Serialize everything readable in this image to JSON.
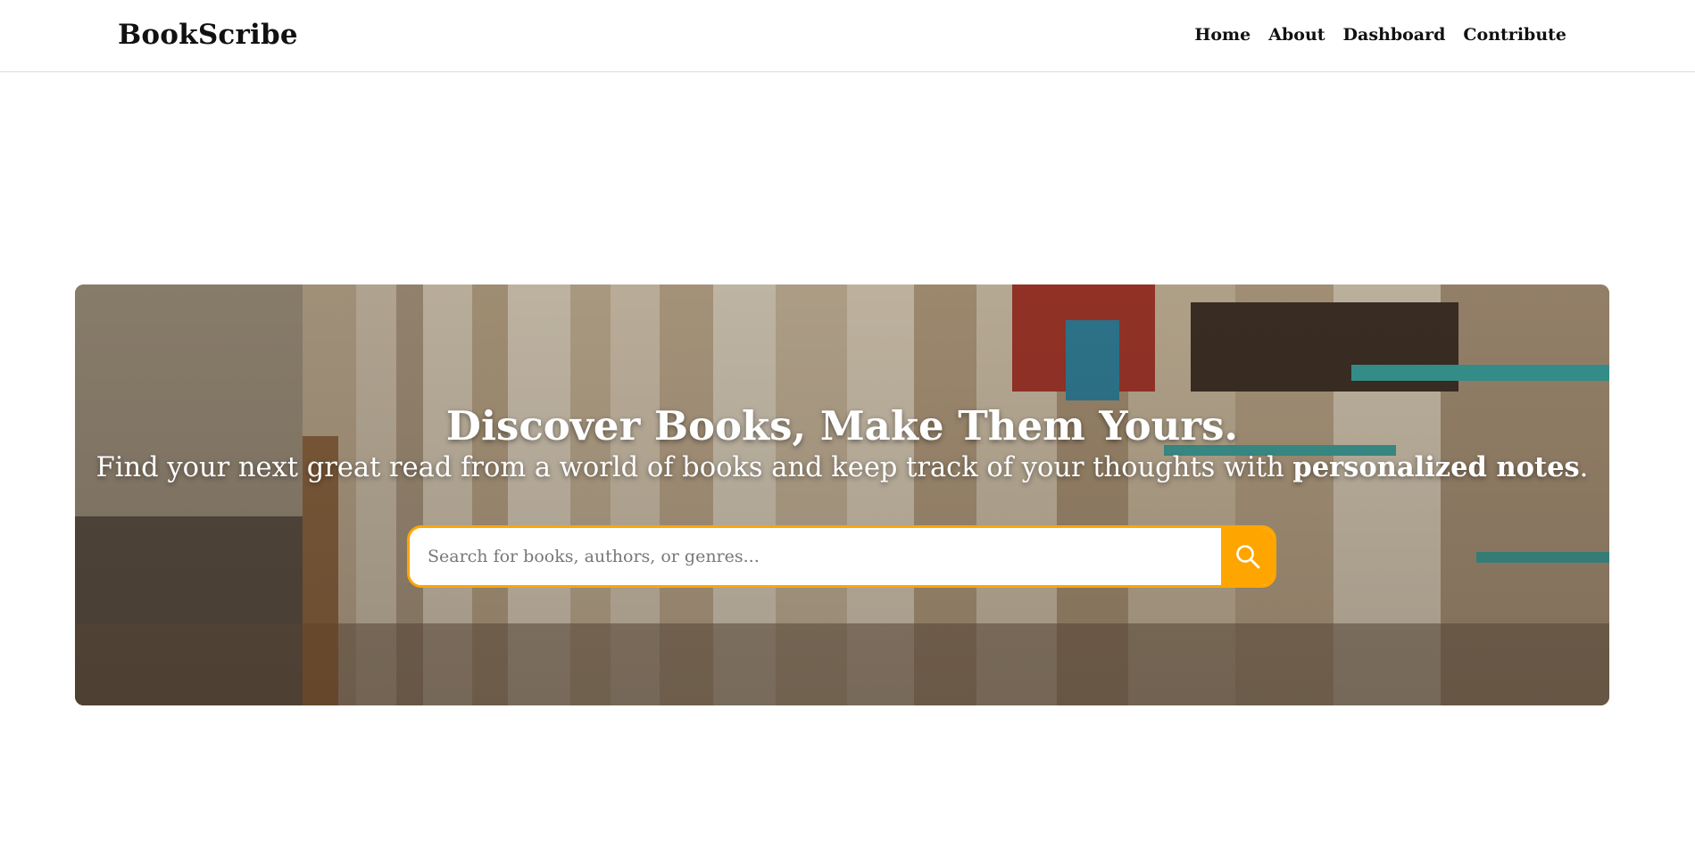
{
  "header": {
    "brand": "BookScribe",
    "nav": [
      {
        "label": "Home"
      },
      {
        "label": "About"
      },
      {
        "label": "Dashboard"
      },
      {
        "label": "Contribute"
      }
    ]
  },
  "hero": {
    "title": "Discover Books, Make Them Yours.",
    "subtitle_prefix": "Find your next great read from a world of books and keep track of your thoughts with ",
    "subtitle_bold": "personalized notes",
    "subtitle_suffix": ".",
    "search": {
      "placeholder": "Search for books, authors, or genres...",
      "value": "",
      "button_icon": "search-icon"
    }
  },
  "colors": {
    "accent": "#ffa500",
    "text": "#111111",
    "hero_text": "#ffffff"
  }
}
